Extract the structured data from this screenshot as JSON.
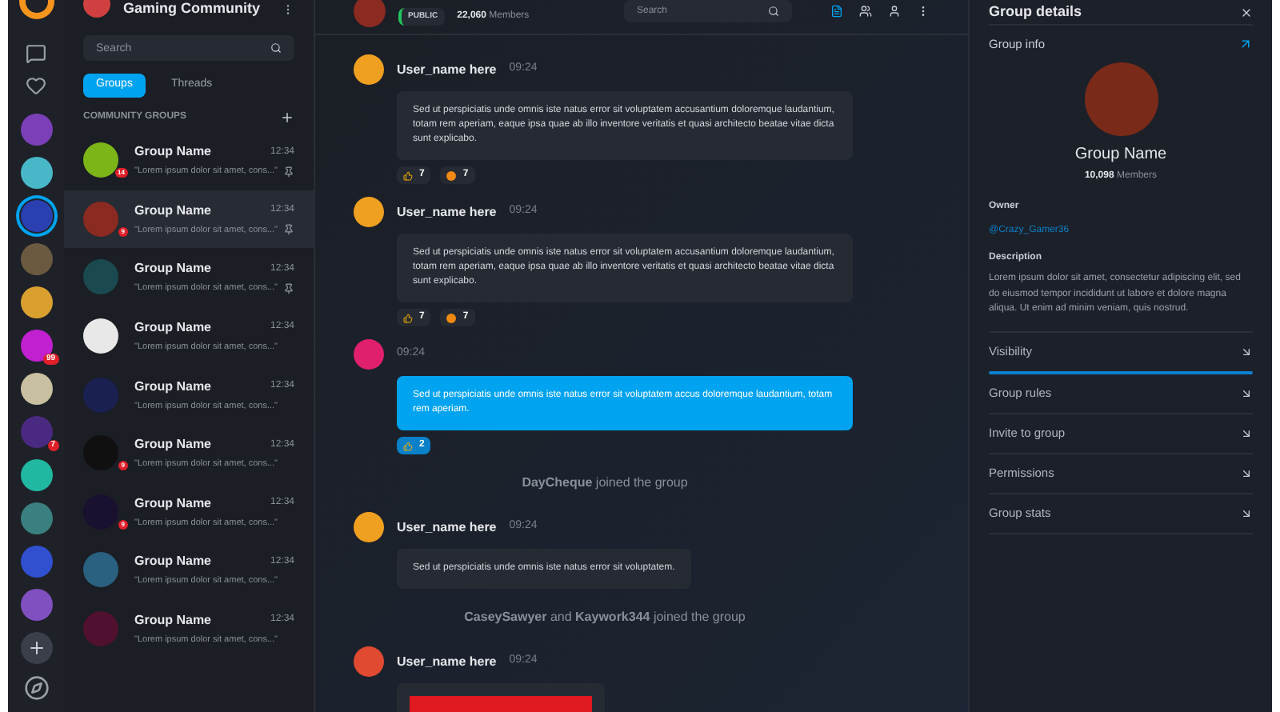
{
  "rail": {
    "avatars": [
      {
        "color": "#7b3fb8",
        "selected": false
      },
      {
        "color": "#48b8c8",
        "selected": false
      },
      {
        "color": "#2a3fb0",
        "selected": true
      },
      {
        "color": "#6b5a40",
        "selected": false
      },
      {
        "color": "#d9a030",
        "selected": false
      },
      {
        "color": "#c020d0",
        "selected": false,
        "badge": "99"
      },
      {
        "color": "#c8c0a0",
        "selected": false
      },
      {
        "color": "#4a2a80",
        "selected": false,
        "badge": "7"
      },
      {
        "color": "#20b8a0",
        "selected": false
      },
      {
        "color": "#3a8080",
        "selected": false
      },
      {
        "color": "#3050d0",
        "selected": false
      },
      {
        "color": "#8050c0",
        "selected": false
      }
    ]
  },
  "sidebar": {
    "title": "Gaming Community",
    "search": {
      "placeholder": "Search"
    },
    "tabs": [
      {
        "label": "Groups",
        "selected": true
      },
      {
        "label": "Threads",
        "selected": false
      }
    ],
    "section": "COMMUNITY GROUPS",
    "groups": [
      {
        "name": "Group Name",
        "preview": "\"Lorem ipsum dolor sit amet, cons...\"",
        "time": "12:34",
        "badge": "14",
        "pinned": true,
        "selected": false,
        "color": "#7cb518"
      },
      {
        "name": "Group Name",
        "preview": "\"Lorem ipsum dolor sit amet, cons...\"",
        "time": "12:34",
        "badge": "9",
        "pinned": true,
        "selected": true,
        "color": "#8a2a20"
      },
      {
        "name": "Group Name",
        "preview": "\"Lorem ipsum dolor sit amet, cons...\"",
        "time": "12:34",
        "pinned": true,
        "selected": false,
        "color": "#1a4a50"
      },
      {
        "name": "Group Name",
        "preview": "\"Lorem ipsum dolor sit amet, cons...\"",
        "time": "12:34",
        "pinned": false,
        "selected": false,
        "color": "#e8e8e8"
      },
      {
        "name": "Group Name",
        "preview": "\"Lorem ipsum dolor sit amet, cons...\"",
        "time": "12:34",
        "pinned": false,
        "selected": false,
        "color": "#1a2050"
      },
      {
        "name": "Group Name",
        "preview": "\"Lorem ipsum dolor sit amet, cons...\"",
        "time": "12:34",
        "badge": "9",
        "pinned": false,
        "selected": false,
        "color": "#101010"
      },
      {
        "name": "Group Name",
        "preview": "\"Lorem ipsum dolor sit amet, cons...\"",
        "time": "12:34",
        "badge": "9",
        "pinned": false,
        "selected": false,
        "color": "#1a1030"
      },
      {
        "name": "Group Name",
        "preview": "\"Lorem ipsum dolor sit amet, cons...\"",
        "time": "12:34",
        "pinned": false,
        "selected": false,
        "color": "#2a6080"
      },
      {
        "name": "Group Name",
        "preview": "\"Lorem ipsum dolor sit amet, cons...\"",
        "time": "12:34",
        "pinned": false,
        "selected": false,
        "color": "#501030"
      }
    ]
  },
  "chat": {
    "header": {
      "visibility": "PUBLIC",
      "members_count": "22,060",
      "members_label": "Members",
      "search": {
        "placeholder": "Search"
      }
    },
    "messages": [
      {
        "kind": "message",
        "user": "User_name here",
        "time": "09:24",
        "own": false,
        "text": "Sed ut perspiciatis unde omnis iste natus error sit voluptatem accusantium doloremque laudantium, totam rem aperiam, eaque ipsa quae ab illo inventore veritatis et quasi architecto beatae vitae dicta sunt explicabo.",
        "reactions": [
          {
            "kind": "like",
            "count": "7",
            "selected": false
          },
          {
            "kind": "wow",
            "count": "7",
            "selected": false
          }
        ]
      },
      {
        "kind": "message",
        "user": "User_name here",
        "time": "09:24",
        "own": false,
        "text": "Sed ut perspiciatis unde omnis iste natus error sit voluptatem accusantium doloremque laudantium, totam rem aperiam, eaque ipsa quae ab illo inventore veritatis et quasi architecto beatae vitae dicta sunt explicabo.",
        "reactions": [
          {
            "kind": "like",
            "count": "7",
            "selected": false
          },
          {
            "kind": "wow",
            "count": "7",
            "selected": false
          }
        ]
      },
      {
        "kind": "message",
        "time": "09:24",
        "own": true,
        "text": "Sed ut perspiciatis unde omnis iste natus error sit voluptatem accus doloremque laudantium, totam rem aperiam.",
        "reactions": [
          {
            "kind": "like",
            "count": "2",
            "selected": true
          }
        ]
      },
      {
        "kind": "event",
        "text": "**DayCheque** joined the group"
      },
      {
        "kind": "message",
        "user": "User_name here",
        "time": "09:24",
        "own": false,
        "text": "Sed ut perspiciatis unde omnis iste natus error sit voluptatem."
      },
      {
        "kind": "event",
        "text": "**CaseySawyer** and **Kaywork344** joined the group"
      },
      {
        "kind": "image",
        "user": "User_name here",
        "time": "09:24"
      }
    ]
  },
  "details": {
    "title": "Group details",
    "info_label": "Group info",
    "name": "Group Name",
    "members_count": "10,098",
    "members_label": "Members",
    "owner_label": "Owner",
    "owner": "@Crazy_Gamer36",
    "description_label": "Description",
    "description": "Lorem ipsum dolor sit amet, consectetur adipiscing elit, sed do eiusmod tempor incididunt ut labore et dolore magna aliqua. Ut enim ad minim veniam, quis nostrud.",
    "sections": [
      {
        "label": "Visibility",
        "selected": true
      },
      {
        "label": "Group rules",
        "selected": false
      },
      {
        "label": "Invite to group",
        "selected": false
      },
      {
        "label": "Permissions",
        "selected": false
      },
      {
        "label": "Group stats",
        "selected": false
      }
    ]
  }
}
